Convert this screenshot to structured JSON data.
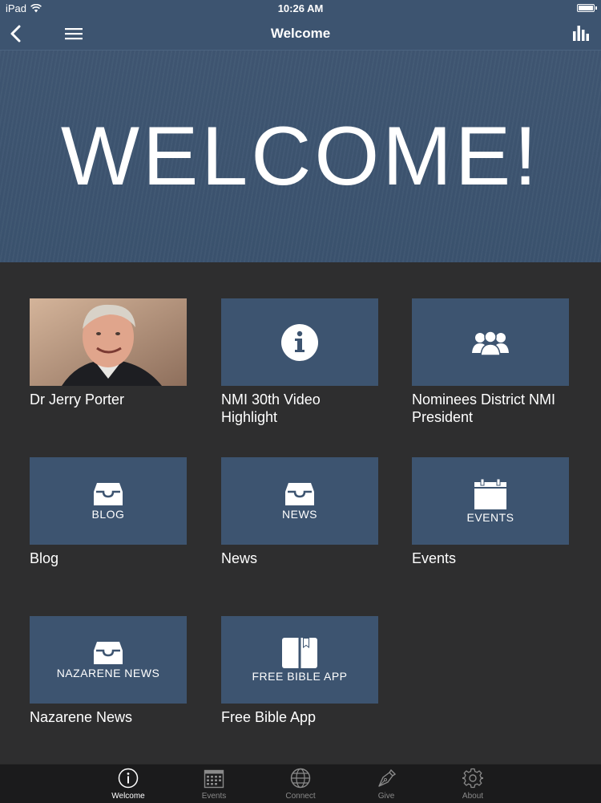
{
  "status_bar": {
    "device": "iPad",
    "time": "10:26 AM"
  },
  "nav": {
    "title": "Welcome"
  },
  "hero": {
    "headline": "WELCOME!"
  },
  "tiles": [
    {
      "caption": "Dr Jerry Porter"
    },
    {
      "caption": "NMI 30th Video Highlight"
    },
    {
      "caption": "Nominees District NMI President"
    },
    {
      "thumb_text": "BLOG",
      "caption": "Blog"
    },
    {
      "thumb_text": "NEWS",
      "caption": "News"
    },
    {
      "thumb_text": "EVENTS",
      "caption": "Events"
    },
    {
      "thumb_text": "NAZARENE NEWS",
      "caption": "Nazarene News"
    },
    {
      "thumb_text": "FREE BIBLE APP",
      "caption": "Free Bible App"
    }
  ],
  "tabs": [
    {
      "label": "Welcome",
      "icon": "info-icon",
      "active": true
    },
    {
      "label": "Events",
      "icon": "calendar-icon",
      "active": false
    },
    {
      "label": "Connect",
      "icon": "globe-icon",
      "active": false
    },
    {
      "label": "Give",
      "icon": "pen-icon",
      "active": false
    },
    {
      "label": "About",
      "icon": "gear-icon",
      "active": false
    }
  ],
  "colors": {
    "accent": "#3d5470",
    "background": "#2e2e2f",
    "tab_bar": "#1b1b1c"
  }
}
